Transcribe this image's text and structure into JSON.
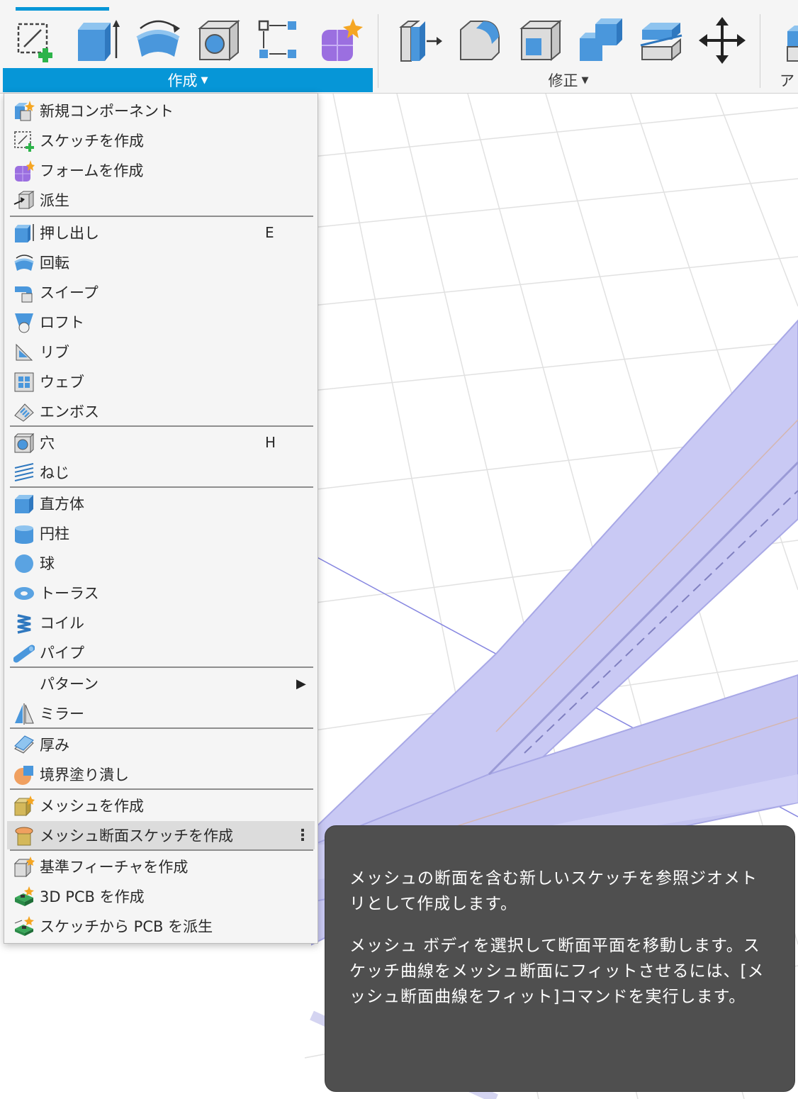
{
  "toolbar": {
    "groups": {
      "create": "作成",
      "modify": "修正",
      "assemble": "ア"
    },
    "create_tools": [
      "create-sketch-icon",
      "extrude-icon",
      "revolve-icon",
      "hole-icon",
      "pattern-icon",
      "create-form-icon"
    ],
    "modify_tools": [
      "press-pull-icon",
      "fillet-icon",
      "shell-icon",
      "combine-icon",
      "offset-face-icon",
      "move-icon"
    ],
    "accent_color": "#0696d7"
  },
  "create_menu": {
    "items": [
      {
        "label": "新規コンポーネント",
        "icon": "new-component-icon"
      },
      {
        "label": "スケッチを作成",
        "icon": "create-sketch-icon"
      },
      {
        "label": "フォームを作成",
        "icon": "create-form-icon"
      },
      {
        "label": "派生",
        "icon": "derive-icon"
      },
      {
        "label": "押し出し",
        "icon": "extrude-icon",
        "shortcut": "E"
      },
      {
        "label": "回転",
        "icon": "revolve-icon"
      },
      {
        "label": "スイープ",
        "icon": "sweep-icon"
      },
      {
        "label": "ロフト",
        "icon": "loft-icon"
      },
      {
        "label": "リブ",
        "icon": "rib-icon"
      },
      {
        "label": "ウェブ",
        "icon": "web-icon"
      },
      {
        "label": "エンボス",
        "icon": "emboss-icon"
      },
      {
        "label": "穴",
        "icon": "hole-icon",
        "shortcut": "H"
      },
      {
        "label": "ねじ",
        "icon": "thread-icon"
      },
      {
        "label": "直方体",
        "icon": "box-icon"
      },
      {
        "label": "円柱",
        "icon": "cylinder-icon"
      },
      {
        "label": "球",
        "icon": "sphere-icon"
      },
      {
        "label": "トーラス",
        "icon": "torus-icon"
      },
      {
        "label": "コイル",
        "icon": "coil-icon"
      },
      {
        "label": "パイプ",
        "icon": "pipe-icon"
      },
      {
        "label": "パターン",
        "icon": "",
        "submenu": "▶"
      },
      {
        "label": "ミラー",
        "icon": "mirror-icon"
      },
      {
        "label": "厚み",
        "icon": "thicken-icon"
      },
      {
        "label": "境界塗り潰し",
        "icon": "boundary-fill-icon"
      },
      {
        "label": "メッシュを作成",
        "icon": "create-mesh-icon"
      },
      {
        "label": "メッシュ断面スケッチを作成",
        "icon": "mesh-section-sketch-icon",
        "highlighted": true,
        "more": "⋮"
      },
      {
        "label": "基準フィーチャを作成",
        "icon": "base-feature-icon"
      },
      {
        "label": "3D PCB を作成",
        "icon": "create-3d-pcb-icon"
      },
      {
        "label": "スケッチから PCB を派生",
        "icon": "derive-pcb-icon"
      }
    ]
  },
  "tooltip": {
    "paragraph1": "メッシュの断面を含む新しいスケッチを参照ジオメトリとして作成します。",
    "paragraph2": "メッシュ ボディを選択して断面平面を移動します。スケッチ曲線をメッシュ断面にフィットさせるには、[メッシュ断面曲線をフィット]コマンドを実行します。"
  }
}
